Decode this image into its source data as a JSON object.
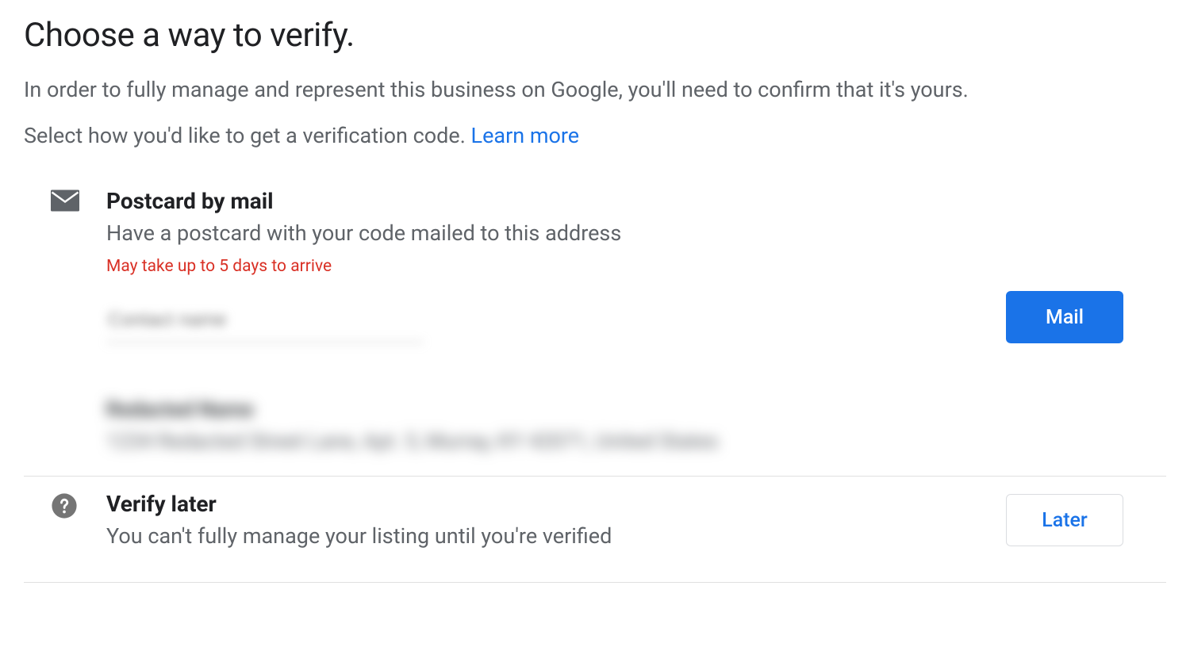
{
  "header": {
    "title": "Choose a way to verify.",
    "intro_line1": "In order to fully manage and represent this business on Google, you'll need to confirm that it's yours.",
    "intro_line2_prefix": "Select how you'd like to get a verification code. ",
    "learn_more_label": "Learn more"
  },
  "options": {
    "postcard": {
      "title": "Postcard by mail",
      "description": "Have a postcard with your code mailed to this address",
      "note": "May take up to 5 days to arrive",
      "contact_placeholder": "Contact name",
      "address_name": "Redacted Name",
      "address_line": "1234 Redacted Street Lane, Apt. 5, Murray, KY 42071, United States",
      "action_label": "Mail"
    },
    "later": {
      "title": "Verify later",
      "description": "You can't fully manage your listing until you're verified",
      "action_label": "Later"
    }
  },
  "colors": {
    "link": "#1a73e8",
    "danger": "#d93025",
    "text_secondary": "#5f6368"
  }
}
